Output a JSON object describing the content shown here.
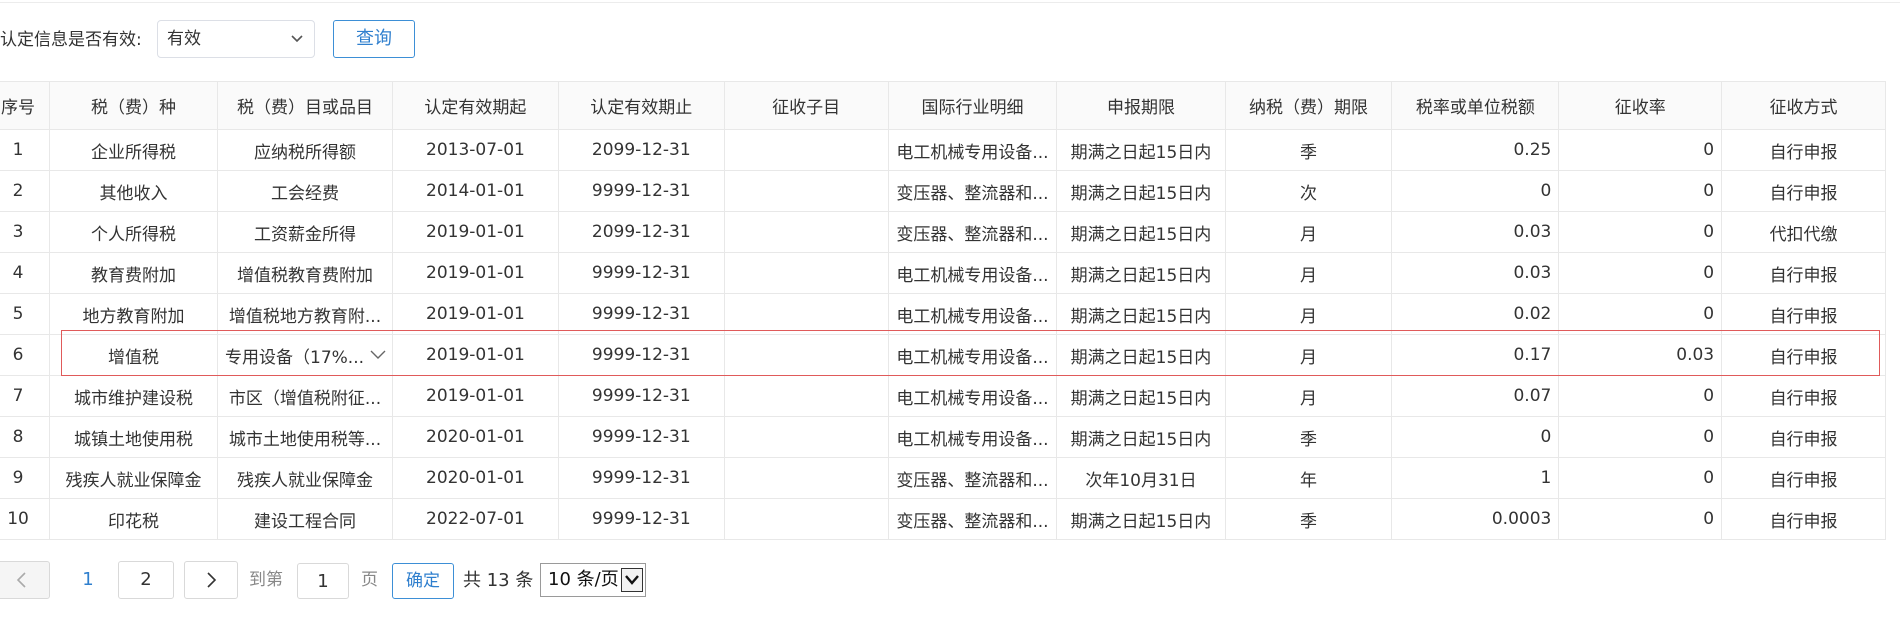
{
  "filter": {
    "label": "认定信息是否有效:",
    "select_value": "有效",
    "query_button": "查询"
  },
  "table": {
    "headers": [
      "序号",
      "税（费）种",
      "税（费）目或品目",
      "认定有效期起",
      "认定有效期止",
      "征收子目",
      "国际行业明细",
      "申报期限",
      "纳税（费）期限",
      "税率或单位税额",
      "征收率",
      "征收方式"
    ],
    "rows": [
      [
        "1",
        "企业所得税",
        "应纳税所得额",
        "2013-07-01",
        "2099-12-31",
        "",
        "电工机械专用设备...",
        "期满之日起15日内",
        "季",
        "0.25",
        "0",
        "自行申报"
      ],
      [
        "2",
        "其他收入",
        "工会经费",
        "2014-01-01",
        "9999-12-31",
        "",
        "变压器、整流器和...",
        "期满之日起15日内",
        "次",
        "0",
        "0",
        "自行申报"
      ],
      [
        "3",
        "个人所得税",
        "工资薪金所得",
        "2019-01-01",
        "2099-12-31",
        "",
        "变压器、整流器和...",
        "期满之日起15日内",
        "月",
        "0.03",
        "0",
        "代扣代缴"
      ],
      [
        "4",
        "教育费附加",
        "增值税教育费附加",
        "2019-01-01",
        "9999-12-31",
        "",
        "电工机械专用设备...",
        "期满之日起15日内",
        "月",
        "0.03",
        "0",
        "自行申报"
      ],
      [
        "5",
        "地方教育附加",
        "增值税地方教育附...",
        "2019-01-01",
        "9999-12-31",
        "",
        "电工机械专用设备...",
        "期满之日起15日内",
        "月",
        "0.02",
        "0",
        "自行申报"
      ],
      [
        "6",
        "增值税",
        "专用设备（17%...",
        "2019-01-01",
        "9999-12-31",
        "",
        "电工机械专用设备...",
        "期满之日起15日内",
        "月",
        "0.17",
        "0.03",
        "自行申报"
      ],
      [
        "7",
        "城市维护建设税",
        "市区（增值税附征...",
        "2019-01-01",
        "9999-12-31",
        "",
        "电工机械专用设备...",
        "期满之日起15日内",
        "月",
        "0.07",
        "0",
        "自行申报"
      ],
      [
        "8",
        "城镇土地使用税",
        "城市土地使用税等...",
        "2020-01-01",
        "9999-12-31",
        "",
        "电工机械专用设备...",
        "期满之日起15日内",
        "季",
        "0",
        "0",
        "自行申报"
      ],
      [
        "9",
        "残疾人就业保障金",
        "残疾人就业保障金",
        "2020-01-01",
        "9999-12-31",
        "",
        "变压器、整流器和...",
        "次年10月31日",
        "年",
        "1",
        "0",
        "自行申报"
      ],
      [
        "10",
        "印花税",
        "建设工程合同",
        "2022-07-01",
        "9999-12-31",
        "",
        "变压器、整流器和...",
        "期满之日起15日内",
        "季",
        "0.0003",
        "0",
        "自行申报"
      ]
    ],
    "highlighted_row": 6
  },
  "pagination": {
    "pages": [
      "1",
      "2"
    ],
    "current": "1",
    "goto_label": "到第",
    "page_suffix": "页",
    "goto_value": "1",
    "confirm": "确定",
    "total": "共 13 条",
    "page_size": "10 条/页"
  },
  "colors": {
    "accent": "#2f7fce",
    "highlight_border": "#e05a5a",
    "header_bg": "#fafafa",
    "border": "#e8e8e8"
  }
}
